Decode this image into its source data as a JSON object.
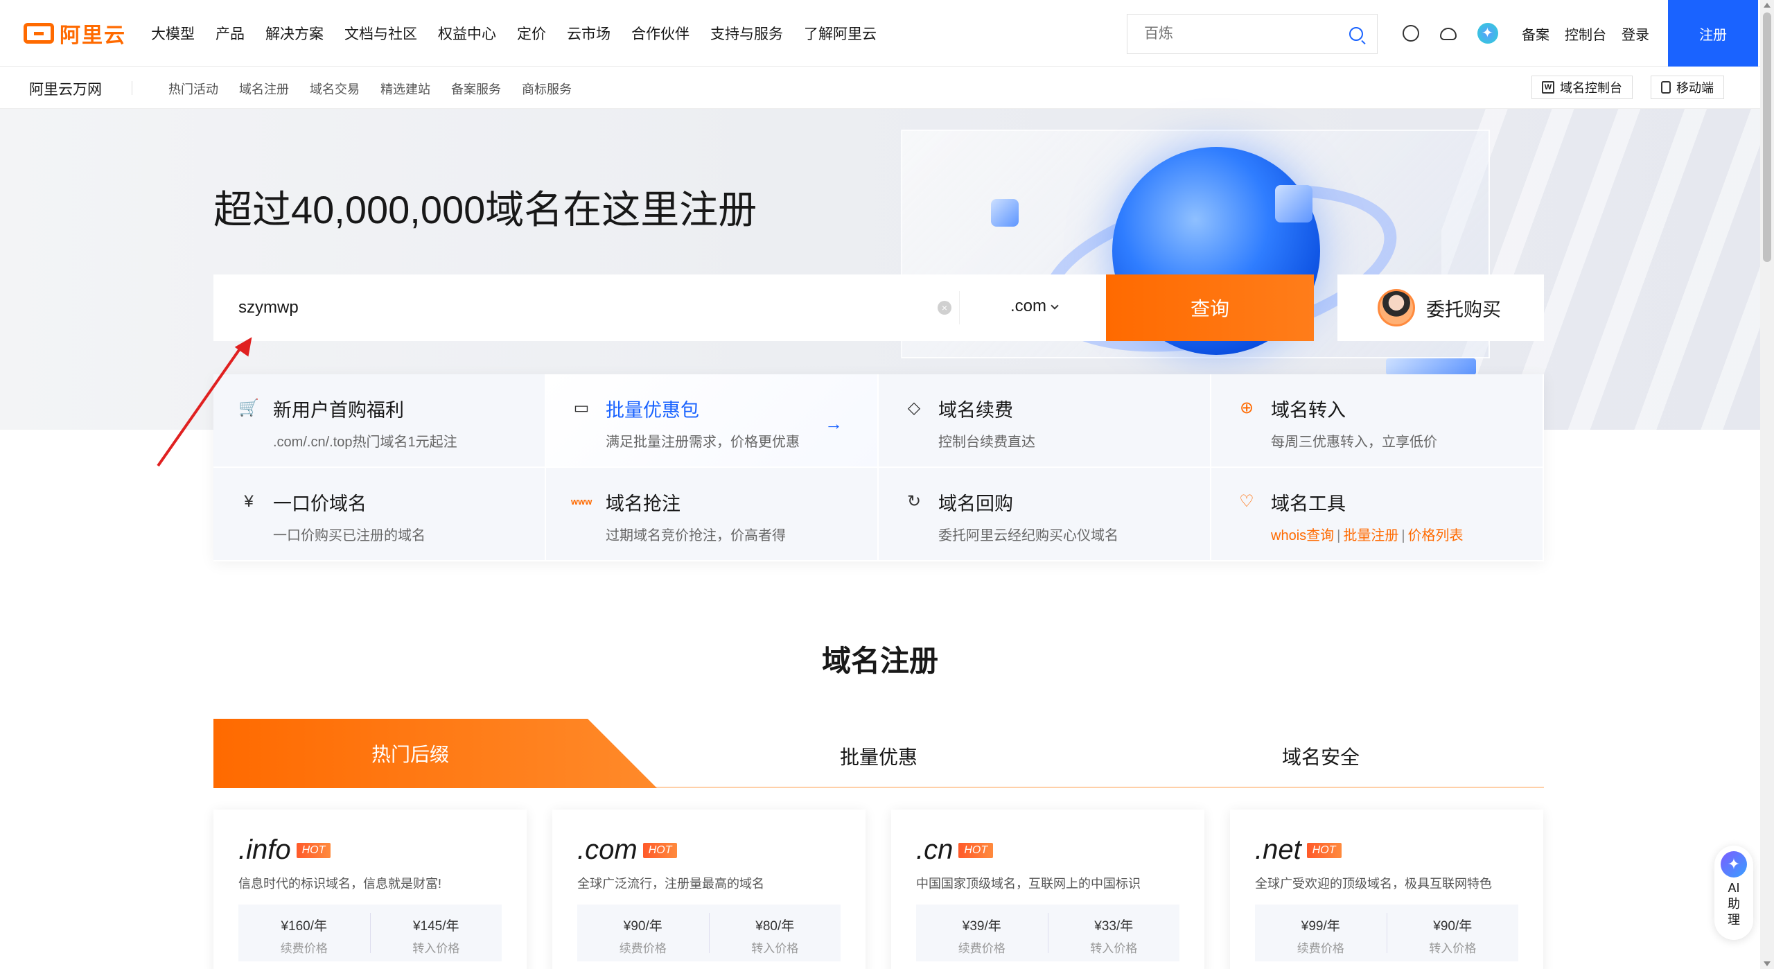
{
  "brand": {
    "name": "阿里云"
  },
  "topnav": {
    "items": [
      "大模型",
      "产品",
      "解决方案",
      "文档与社区",
      "权益中心",
      "定价",
      "云市场",
      "合作伙伴",
      "支持与服务",
      "了解阿里云"
    ],
    "search_placeholder": "百炼",
    "links": {
      "beian": "备案",
      "console": "控制台",
      "login": "登录",
      "register": "注册"
    }
  },
  "subnav": {
    "title": "阿里云万网",
    "items": [
      "热门活动",
      "域名注册",
      "域名交易",
      "精选建站",
      "备案服务",
      "商标服务"
    ],
    "domain_console": "域名控制台",
    "mobile": "移动端"
  },
  "hero": {
    "title": "超过40,000,000域名在这里注册",
    "search_value": "szymwp",
    "suffix": ".com",
    "query_button": "查询",
    "delegate_button": "委托购买"
  },
  "features": [
    {
      "title": "新用户首购福利",
      "desc": ".com/.cn/.top热门域名1元起注",
      "icon": "cart-icon"
    },
    {
      "title": "批量优惠包",
      "desc": "满足批量注册需求，价格更优惠",
      "icon": "package-icon"
    },
    {
      "title": "域名续费",
      "desc": "控制台续费直达",
      "icon": "tag-icon"
    },
    {
      "title": "域名转入",
      "desc": "每周三优惠转入，立享低价",
      "icon": "transfer-icon"
    },
    {
      "title": "一口价域名",
      "desc": "一口价购买已注册的域名",
      "icon": "price-icon"
    },
    {
      "title": "域名抢注",
      "desc": "过期域名竞价抢注，价高者得",
      "icon": "www-icon"
    },
    {
      "title": "域名回购",
      "desc": "委托阿里云经纪购买心仪域名",
      "icon": "buyback-icon"
    },
    {
      "title": "域名工具",
      "icon": "tool-icon",
      "links": [
        "whois查询",
        "批量注册",
        "价格列表"
      ]
    }
  ],
  "section": {
    "title": "域名注册",
    "tabs": [
      "热门后缀",
      "批量优惠",
      "域名安全"
    ]
  },
  "cards": [
    {
      "name": ".info",
      "badge": "HOT",
      "desc": "信息时代的标识域名，信息就是财富!",
      "renew_price": "¥160/年",
      "renew_label": "续费价格",
      "transfer_price": "¥145/年",
      "transfer_label": "转入价格"
    },
    {
      "name": ".com",
      "badge": "HOT",
      "desc": "全球广泛流行，注册量最高的域名",
      "renew_price": "¥90/年",
      "renew_label": "续费价格",
      "transfer_price": "¥80/年",
      "transfer_label": "转入价格"
    },
    {
      "name": ".cn",
      "badge": "HOT",
      "desc": "中国国家顶级域名，互联网上的中国标识",
      "renew_price": "¥39/年",
      "renew_label": "续费价格",
      "transfer_price": "¥33/年",
      "transfer_label": "转入价格"
    },
    {
      "name": ".net",
      "badge": "HOT",
      "desc": "全球广受欢迎的顶级域名，极具互联网特色",
      "renew_price": "¥99/年",
      "renew_label": "续费价格",
      "transfer_price": "¥90/年",
      "transfer_label": "转入价格"
    }
  ],
  "ai_helper": {
    "line1": "AI",
    "line2": "助",
    "line3": "理"
  },
  "colors": {
    "accent": "#ff6a00",
    "primary": "#1a63ff"
  }
}
